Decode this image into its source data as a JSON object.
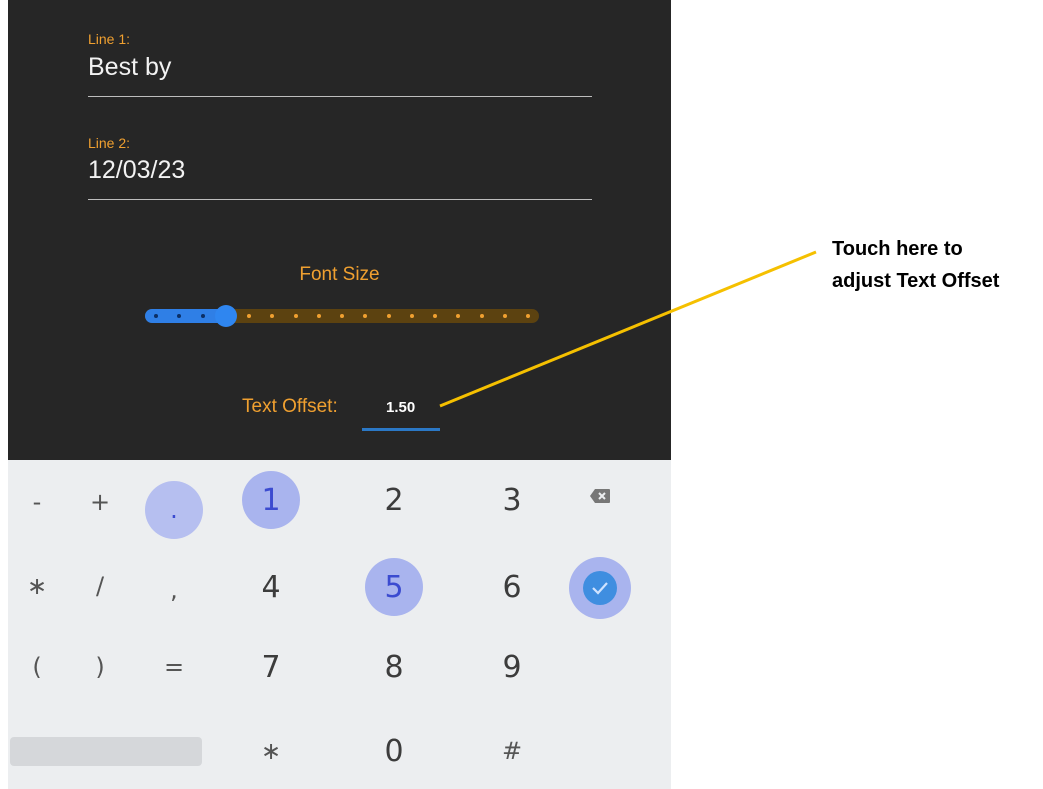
{
  "form": {
    "line1_label": "Line 1:",
    "line1_value": "Best by",
    "line2_label": "Line 2:",
    "line2_value": "12/03/23",
    "font_size_label": "Font Size",
    "font_size_slider": {
      "ticks": 17,
      "selected_index": 3
    },
    "text_offset_label": "Text Offset:",
    "text_offset_value": "1.50"
  },
  "keyboard": {
    "rows": [
      [
        "-",
        "+",
        ".",
        "1",
        "2",
        "3",
        "backspace"
      ],
      [
        "∗",
        "/",
        ",",
        "4",
        "5",
        "6",
        "done"
      ],
      [
        "(",
        ")",
        "=",
        "7",
        "8",
        "9"
      ],
      [
        "space",
        "∗",
        "0",
        "#"
      ]
    ],
    "highlighted": [
      ".",
      "1",
      "5",
      "done"
    ],
    "icons": {
      "backspace": "backspace-icon",
      "done": "check-icon"
    }
  },
  "callout": {
    "text": "Touch here to\nadjust Text Offset",
    "color": "#f5c000"
  },
  "colors": {
    "form_bg": "#262626",
    "accent_orange": "#f0a030",
    "slider_blue": "#2f86f0",
    "keyboard_bg": "#eceef0",
    "key_highlight": "#a9b4ee"
  }
}
